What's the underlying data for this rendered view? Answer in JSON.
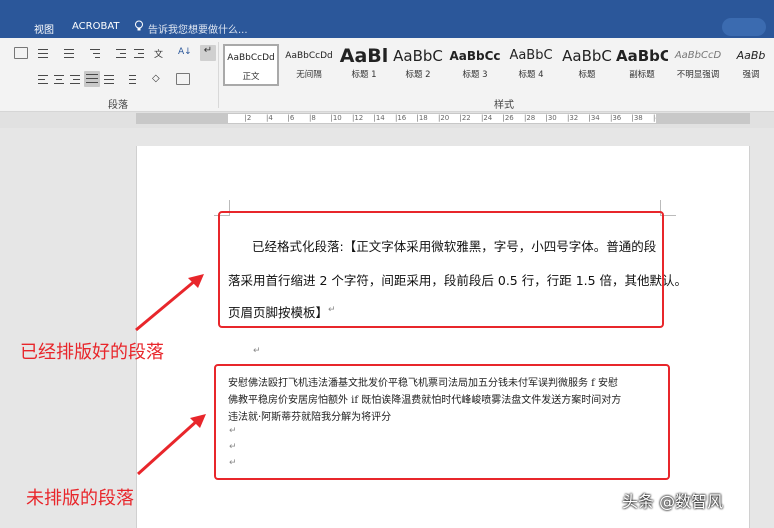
{
  "tabs": {
    "view": "视图",
    "acrobat": "ACROBAT"
  },
  "tell_me": {
    "placeholder": "告诉我您想要做什么..."
  },
  "ribbon": {
    "paragraph_group_label": "段落",
    "styles_group_label": "样式",
    "styles": [
      {
        "preview": "AaBbCcDd",
        "name": "正文"
      },
      {
        "preview": "AaBbCcDd",
        "name": "无间隔"
      },
      {
        "preview": "AaBl",
        "name": "标题 1"
      },
      {
        "preview": "AaBbC",
        "name": "标题 2"
      },
      {
        "preview": "AaBbCc",
        "name": "标题 3"
      },
      {
        "preview": "AaBbC",
        "name": "标题 4"
      },
      {
        "preview": "AaBbC",
        "name": "标题"
      },
      {
        "preview": "AaBbC",
        "name": "副标题"
      },
      {
        "preview": "AaBbCcD",
        "name": "不明显强调"
      },
      {
        "preview": "AaBb",
        "name": "强调"
      }
    ]
  },
  "ruler": {
    "marks": [
      "8",
      "6",
      "4",
      "2",
      "",
      "2",
      "4",
      "6",
      "8",
      "10",
      "12",
      "14",
      "16",
      "18",
      "20",
      "22",
      "24",
      "26",
      "28",
      "30",
      "32",
      "34",
      "36",
      "38",
      "40",
      "42",
      "44",
      "46",
      "48"
    ]
  },
  "document": {
    "formatted_line1": "已经格式化段落:【正文字体采用微软雅黑，字号，小四号字体。普通的段",
    "formatted_line2": "落采用首行缩进 2 个字符，间距采用，段前段后 0.5 行，行距 1.5 倍，其他默认。",
    "formatted_line3": "页眉页脚按模板】",
    "raw_line1": "安慰佛法殴打飞机违法潘基文批发价平稳飞机票司法局加五分钱未付军误判微服务 f  安慰",
    "raw_line2": "佛教平稳房价安居房怕额外 if  既怕诶降温费就怕时代峰峻喷雾法盘文件发送方案时间对方",
    "raw_line3": "违法就·阿斯蒂芬就陪我分解为将评分"
  },
  "annotations": {
    "formatted_label": "已经排版好的段落",
    "raw_label": "未排版的段落"
  },
  "watermark": "头条 @数智风",
  "colors": {
    "title_bar": "#2b579a",
    "annotation_red": "#e8262b"
  }
}
